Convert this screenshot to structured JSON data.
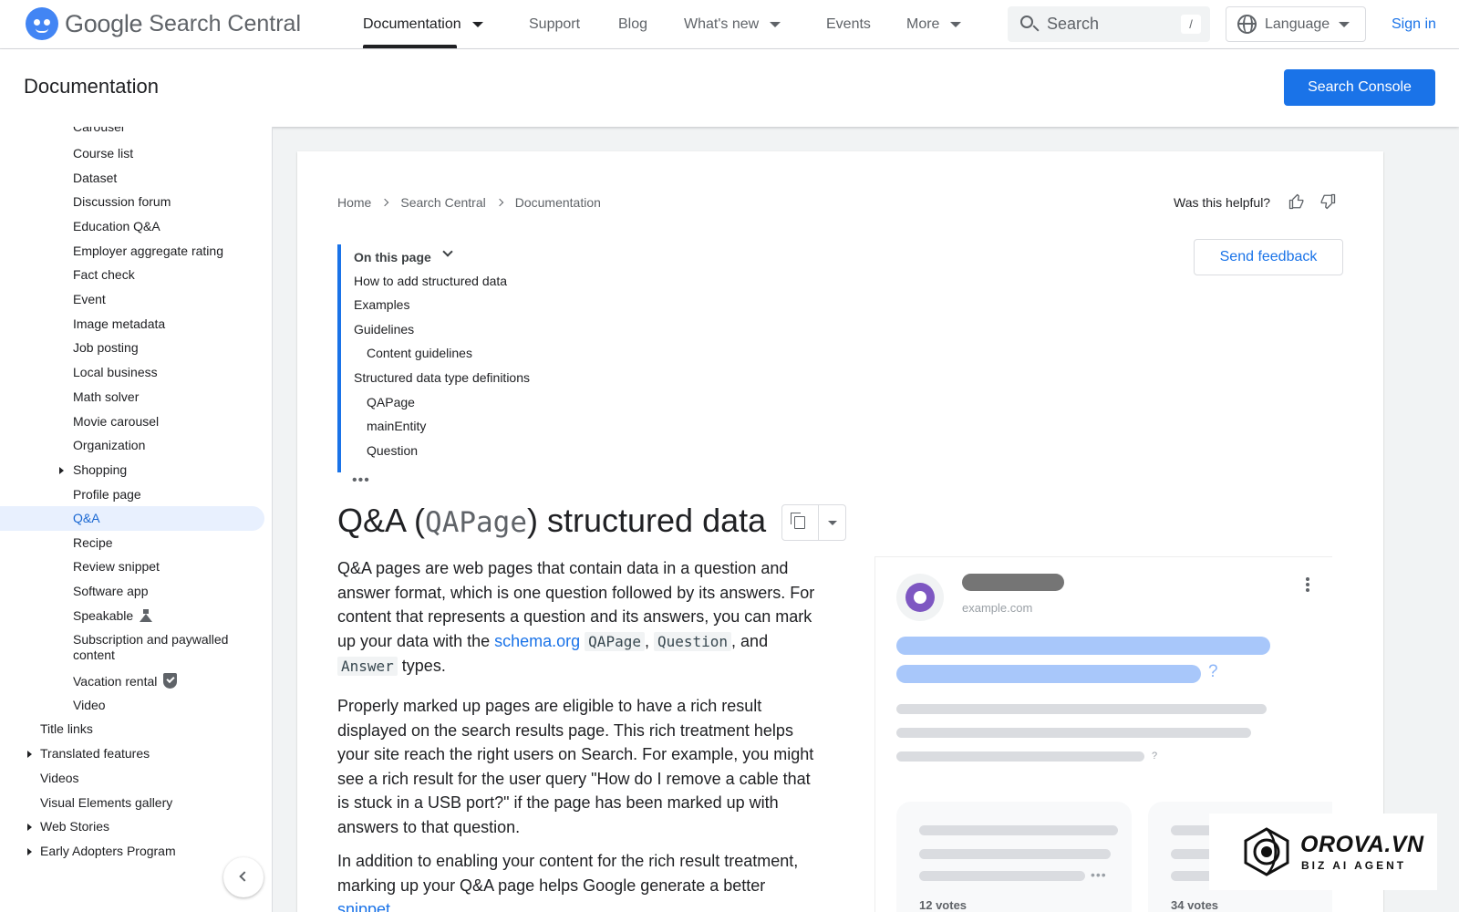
{
  "header": {
    "logo_google": "Google",
    "logo_product": "Search Central",
    "nav": {
      "documentation": "Documentation",
      "support": "Support",
      "blog": "Blog",
      "whats_new": "What's new",
      "events": "Events",
      "more": "More"
    },
    "search_placeholder": "Search",
    "search_shortcut": "/",
    "language": "Language",
    "sign_in": "Sign in"
  },
  "subbar": {
    "title": "Documentation",
    "console_button": "Search Console"
  },
  "sidebar": {
    "items": [
      {
        "label": "Carousel"
      },
      {
        "label": "Course list"
      },
      {
        "label": "Dataset"
      },
      {
        "label": "Discussion forum"
      },
      {
        "label": "Education Q&A"
      },
      {
        "label": "Employer aggregate rating"
      },
      {
        "label": "Fact check"
      },
      {
        "label": "Event"
      },
      {
        "label": "Image metadata"
      },
      {
        "label": "Job posting"
      },
      {
        "label": "Local business"
      },
      {
        "label": "Math solver"
      },
      {
        "label": "Movie carousel"
      },
      {
        "label": "Organization"
      },
      {
        "label": "Shopping"
      },
      {
        "label": "Profile page"
      },
      {
        "label": "Q&A"
      },
      {
        "label": "Recipe"
      },
      {
        "label": "Review snippet"
      },
      {
        "label": "Software app"
      },
      {
        "label": "Speakable"
      },
      {
        "label": "Subscription and paywalled content"
      },
      {
        "label": "Vacation rental"
      },
      {
        "label": "Video"
      },
      {
        "label": "Title links"
      },
      {
        "label": "Translated features"
      },
      {
        "label": "Videos"
      },
      {
        "label": "Visual Elements gallery"
      },
      {
        "label": "Web Stories"
      },
      {
        "label": "Early Adopters Program"
      }
    ],
    "selected": "Q&A"
  },
  "breadcrumb": [
    "Home",
    "Search Central",
    "Documentation"
  ],
  "helpful": {
    "label": "Was this helpful?",
    "thumb_up": "thumb-up-icon",
    "thumb_down": "thumb-down-icon"
  },
  "feedback_button": "Send feedback",
  "toc": {
    "heading": "On this page",
    "items": [
      "How to add structured data",
      "Examples",
      "Guidelines",
      "Content guidelines",
      "Structured data type definitions",
      "QAPage",
      "mainEntity",
      "Question"
    ],
    "more": "•••"
  },
  "page": {
    "title_pre": "Q&A (",
    "title_code": "QAPage",
    "title_post": ") structured data",
    "p1": {
      "text_a": "Q&A pages are web pages that contain data in a question and answer format, which is one question followed by its answers. For content that represents a question and its answers, you can mark up your data with the ",
      "link": "schema.org",
      "code1": "QAPage",
      "sep1": ", ",
      "code2": "Question",
      "sep2": ", and ",
      "code3": "Answer",
      "text_b": " types."
    },
    "p2": "Properly marked up pages are eligible to have a rich result displayed on the search results page. This rich treatment helps your site reach the right users on Search. For example, you might see a rich result for the user query \"How do I remove a cable that is stuck in a USB port?\" if the page has been marked up with answers to that question.",
    "p3": {
      "text_a": "In addition to enabling your content for the rich result treatment, marking up your Q&A page helps Google generate a better ",
      "link": "snippet"
    }
  },
  "illustration": {
    "site": "example.com",
    "qmark": "?",
    "dots": "•••",
    "votes": [
      "12 votes",
      "34 votes"
    ]
  },
  "watermark": {
    "brand": "OROVA.VN",
    "tagline": "BIZ AI AGENT"
  },
  "colors": {
    "accent": "#1a73e8",
    "selected_bg": "#e8f0fe",
    "placeholder_blue": "#a8c7fa",
    "placeholder_grey": "#dadce0"
  }
}
